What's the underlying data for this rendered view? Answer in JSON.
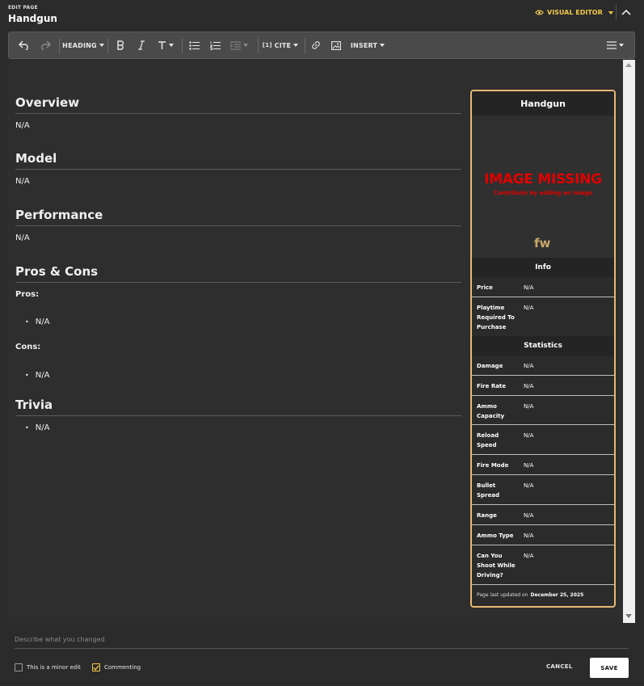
{
  "header": {
    "edit_label": "EDIT PAGE",
    "page_title": "Handgun",
    "mode_label": "VISUAL EDITOR"
  },
  "toolbar": {
    "heading_label": "HEADING",
    "cite_label": "CITE",
    "insert_label": "INSERT"
  },
  "content": {
    "sections": [
      {
        "title": "Overview",
        "text": "N/A"
      },
      {
        "title": "Model",
        "text": "N/A"
      },
      {
        "title": "Performance",
        "text": "N/A"
      },
      {
        "title": "Pros & Cons",
        "pros_label": "Pros:",
        "pros": [
          "N/A"
        ],
        "cons_label": "Cons:",
        "cons": [
          "N/A"
        ]
      },
      {
        "title": "Trivia",
        "bullets": [
          "N/A"
        ]
      }
    ]
  },
  "infobox": {
    "title": "Handgun",
    "image_missing": "IMAGE MISSING",
    "image_missing_sub": "Contribute by adding an image",
    "logo_text": "fw",
    "info_header": "Info",
    "info_rows": [
      {
        "label": "Price",
        "value": "N/A"
      },
      {
        "label": "Playtime Required To Purchase",
        "value": "N/A"
      }
    ],
    "stats_header": "Statistics",
    "stats_rows": [
      {
        "label": "Damage",
        "value": "N/A"
      },
      {
        "label": "Fire Rate",
        "value": "N/A"
      },
      {
        "label": "Ammo Capacity",
        "value": "N/A"
      },
      {
        "label": "Reload Speed",
        "value": "N/A"
      },
      {
        "label": "Fire Mode",
        "value": "N/A"
      },
      {
        "label": "Bullet Spread",
        "value": "N/A"
      },
      {
        "label": "Range",
        "value": "N/A"
      },
      {
        "label": "Ammo Type",
        "value": "N/A"
      },
      {
        "label": "Can You Shoot While Driving?",
        "value": "N/A"
      }
    ],
    "footer_prefix": "Page last updated on",
    "footer_date": "December 25, 2025"
  },
  "footer": {
    "summary_placeholder": "Describe what you changed",
    "minor_edit_label": "This is a minor edit",
    "commenting_label": "Commenting",
    "cancel_label": "CANCEL",
    "save_label": "SAVE"
  },
  "colors": {
    "accent": "#f2c94c",
    "infobox_border": "#e8b874",
    "image_missing": "#e00000"
  }
}
